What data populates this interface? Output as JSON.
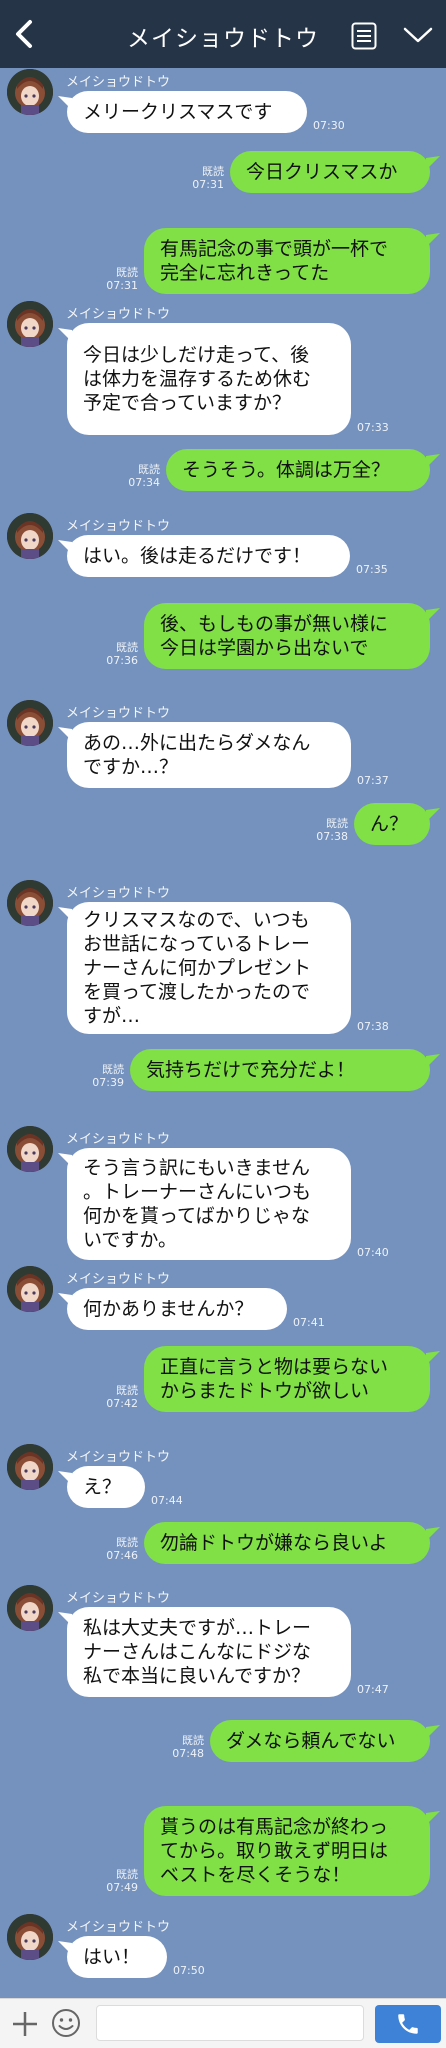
{
  "header": {
    "title": "メイショウドトウ"
  },
  "contact": {
    "name": "メイショウドトウ"
  },
  "read_label": "既読",
  "messages": [
    {
      "dir": "in",
      "show_name": true,
      "text": "メリークリスマスです",
      "time": "07:30"
    },
    {
      "dir": "out",
      "text": "今日クリスマスか",
      "time": "07:31"
    },
    {
      "dir": "out",
      "text": "有馬記念の事で頭が一杯で\n完全に忘れきってた",
      "time": "07:31"
    },
    {
      "dir": "in",
      "show_name": true,
      "text": "今日は少しだけ走って、後\nは体力を温存するため休む\n予定で合っていますか？",
      "time": "07:33"
    },
    {
      "dir": "out",
      "text": "そうそう。体調は万全？",
      "time": "07:34"
    },
    {
      "dir": "in",
      "show_name": true,
      "text": "はい。後は走るだけです！",
      "time": "07:35"
    },
    {
      "dir": "out",
      "text": "後、もしもの事が無い様に\n今日は学園から出ないで",
      "time": "07:36"
    },
    {
      "dir": "in",
      "show_name": true,
      "text": "あの…外に出たらダメなん\nですか…？",
      "time": "07:37"
    },
    {
      "dir": "out",
      "text": "ん？",
      "time": "07:38"
    },
    {
      "dir": "in",
      "show_name": true,
      "text": "クリスマスなので、いつも\nお世話になっているトレー\nナーさんに何かプレゼント\nを買って渡したかったので\nすが…",
      "time": "07:38"
    },
    {
      "dir": "out",
      "text": "気持ちだけで充分だよ！",
      "time": "07:39"
    },
    {
      "dir": "in",
      "show_name": true,
      "text": "そう言う訳にもいきません\n。トレーナーさんにいつも\n何かを貰ってばかりじゃな\nいですか。",
      "time": "07:40"
    },
    {
      "dir": "in",
      "show_name": true,
      "text": "何かありませんか？",
      "time": "07:41"
    },
    {
      "dir": "out",
      "text": "正直に言うと物は要らない\nからまたドトウが欲しい",
      "time": "07:42"
    },
    {
      "dir": "in",
      "show_name": true,
      "text": "え？",
      "time": "07:44"
    },
    {
      "dir": "out",
      "text": "勿論ドトウが嫌なら良いよ",
      "time": "07:46"
    },
    {
      "dir": "in",
      "show_name": true,
      "text": "私は大丈夫ですが…トレー\nナーさんはこんなにドジな\n私で本当に良いんですか？",
      "time": "07:47"
    },
    {
      "dir": "out",
      "text": "ダメなら頼んでない",
      "time": "07:48"
    },
    {
      "dir": "out",
      "text": "貰うのは有馬記念が終わっ\nてから。取り敢えず明日は\nベストを尽くそうな！",
      "time": "07:49"
    },
    {
      "dir": "in",
      "show_name": true,
      "text": "はい！",
      "time": "07:50"
    }
  ],
  "composer": {
    "input_value": "",
    "input_placeholder": ""
  },
  "icons": {
    "back": "chevron-left-icon",
    "menu": "menu-icon",
    "expand": "chevron-down-icon",
    "add": "plus-icon",
    "emoji": "smiley-icon",
    "call": "phone-icon"
  },
  "colors": {
    "background": "#7492bd",
    "header": "#263448",
    "incoming_bubble": "#ffffff",
    "outgoing_bubble": "#80e046",
    "call_button": "#3e82d8"
  }
}
